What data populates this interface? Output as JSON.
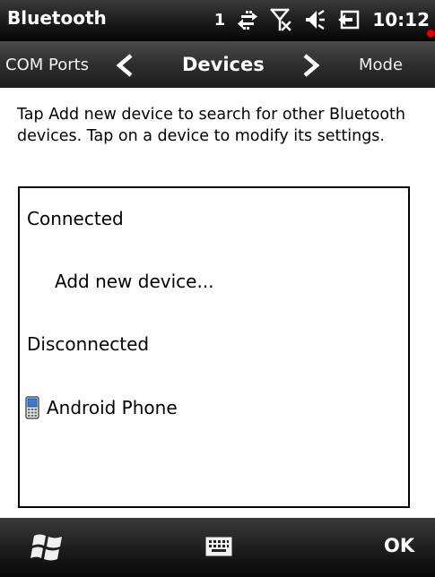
{
  "titlebar": {
    "title": "Bluetooth",
    "signal_number": "1",
    "time": "10:12"
  },
  "nav": {
    "prev_tab": "COM Ports",
    "current_tab": "Devices",
    "next_tab": "Mode"
  },
  "content": {
    "instructions": "Tap Add new device to search for other Bluetooth devices. Tap on a device to modify its settings.",
    "list": {
      "connected_header": "Connected",
      "add_new": "Add new device...",
      "disconnected_header": "Disconnected",
      "devices": [
        {
          "name": "Android Phone",
          "icon": "phone-icon"
        }
      ]
    }
  },
  "bottombar": {
    "ok_label": "OK"
  }
}
